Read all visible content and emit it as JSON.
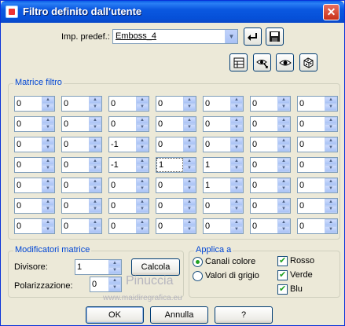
{
  "window": {
    "title": "Filtro definito dall'utente",
    "close_glyph": "✕"
  },
  "preset": {
    "label": "Imp. predef.:",
    "value": "Emboss_4"
  },
  "toolbar_icons": [
    "undo-arrow-icon",
    "save-disk-icon",
    "grid-icon",
    "eye-arrow-icon",
    "eye-icon",
    "dice-icon"
  ],
  "matrix": {
    "legend": "Matrice filtro",
    "rows": [
      [
        "0",
        "0",
        "0",
        "0",
        "0",
        "0",
        "0"
      ],
      [
        "0",
        "0",
        "0",
        "0",
        "0",
        "0",
        "0"
      ],
      [
        "0",
        "0",
        "-1",
        "0",
        "0",
        "0",
        "0"
      ],
      [
        "0",
        "0",
        "-1",
        "1",
        "1",
        "0",
        "0"
      ],
      [
        "0",
        "0",
        "0",
        "0",
        "1",
        "0",
        "0"
      ],
      [
        "0",
        "0",
        "0",
        "0",
        "0",
        "0",
        "0"
      ],
      [
        "0",
        "0",
        "0",
        "0",
        "0",
        "0",
        "0"
      ]
    ]
  },
  "modifiers": {
    "legend": "Modificatori matrice",
    "divisor_label": "Divisore:",
    "divisor_value": "1",
    "bias_label": "Polarizzazione:",
    "bias_value": "0",
    "calc_label": "Calcola"
  },
  "apply": {
    "legend": "Applica a",
    "radio_color": "Canali colore",
    "radio_gray": "Valori di grigio",
    "selected": "Canali colore",
    "checks": [
      {
        "label": "Rosso",
        "checked": true
      },
      {
        "label": "Verde",
        "checked": true
      },
      {
        "label": "Blu",
        "checked": true
      }
    ]
  },
  "watermark": {
    "name": "Pinuccia",
    "site": "www.maidiregrafica.eu"
  },
  "buttons": {
    "ok": "OK",
    "cancel": "Annulla",
    "help": "?"
  },
  "colors": {
    "title_bar": "#0a58e0",
    "legend_text": "#0046d5",
    "dialog_bg": "#ece9d8"
  }
}
